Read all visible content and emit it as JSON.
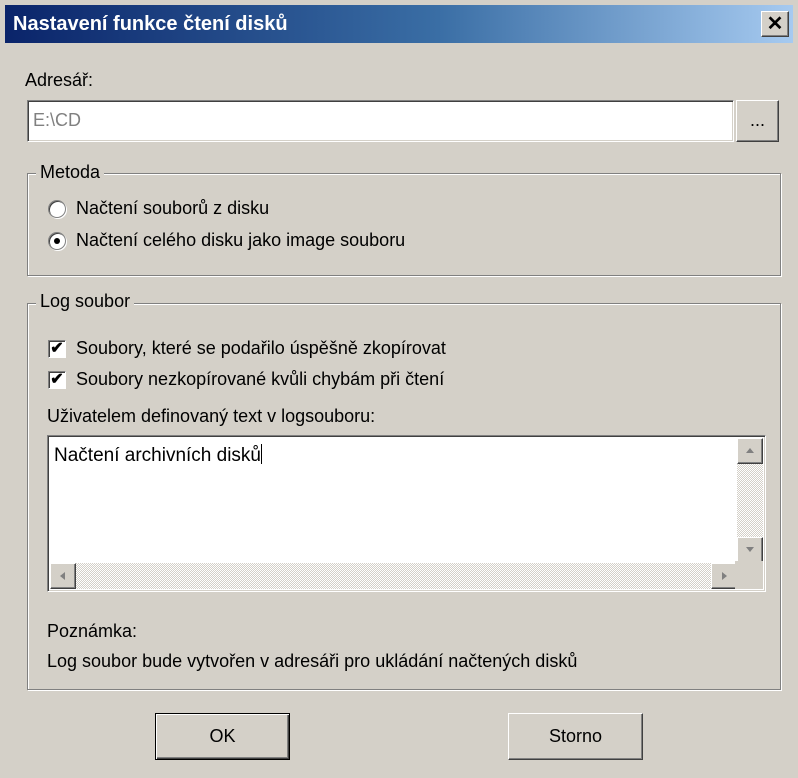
{
  "window": {
    "title": "Nastavení funkce čtení disků",
    "close_symbol": "✕"
  },
  "directory": {
    "label": "Adresář:",
    "value": "E:\\CD",
    "browse_label": "..."
  },
  "method": {
    "legend": "Metoda",
    "options": [
      {
        "label": "Načtení souborů z disku",
        "selected": false
      },
      {
        "label": "Načtení celého disku jako image souboru",
        "selected": true
      }
    ]
  },
  "log": {
    "legend": "Log soubor",
    "checkboxes": [
      {
        "label": "Soubory, které se podařilo úspěšně zkopírovat",
        "checked": true
      },
      {
        "label": "Soubory nezkopírované kvůli chybám při čtení",
        "checked": true
      }
    ],
    "custom_text_label": "Uživatelem definovaný text v logsouboru:",
    "custom_text_value": "Načtení archivních disků",
    "note_label": "Poznámka:",
    "note_text": "Log soubor bude vytvořen v adresáři pro ukládání načtených disků"
  },
  "buttons": {
    "ok_label": "OK",
    "cancel_label": "Storno"
  }
}
